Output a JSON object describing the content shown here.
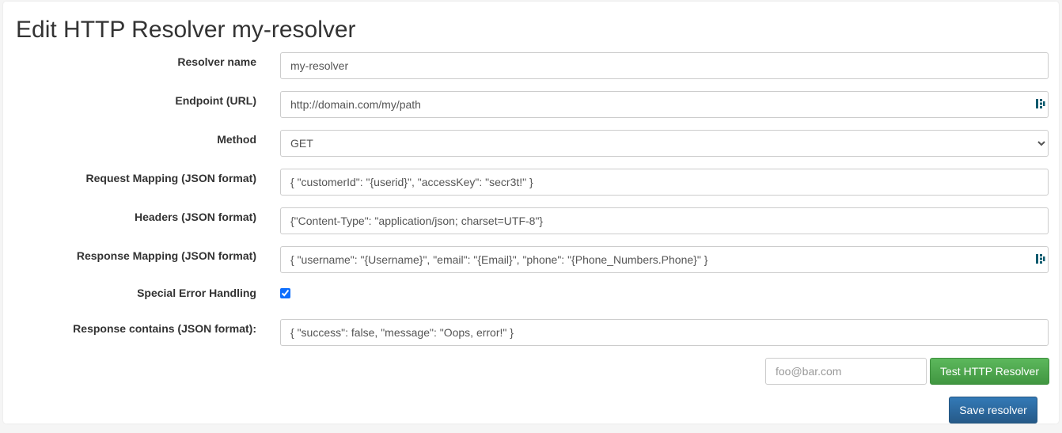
{
  "page": {
    "title": "Edit HTTP Resolver my-resolver"
  },
  "form": {
    "resolver_name": {
      "label": "Resolver name",
      "value": "my-resolver"
    },
    "endpoint": {
      "label": "Endpoint (URL)",
      "value": "http://domain.com/my/path"
    },
    "method": {
      "label": "Method",
      "value": "GET",
      "options": [
        "GET"
      ]
    },
    "request_mapping": {
      "label": "Request Mapping (JSON format)",
      "value": "{ \"customerId\": \"{userid}\", \"accessKey\": \"secr3t!\" }"
    },
    "headers": {
      "label": "Headers (JSON format)",
      "value": "{\"Content-Type\": \"application/json; charset=UTF-8\"}"
    },
    "response_mapping": {
      "label": "Response Mapping (JSON format)",
      "value": "{ \"username\": \"{Username}\", \"email\": \"{Email}\", \"phone\": \"{Phone_Numbers.Phone}\" }"
    },
    "special_error_handling": {
      "label": "Special Error Handling",
      "checked": true
    },
    "response_contains": {
      "label": "Response contains (JSON format):",
      "value": "{ \"success\": false, \"message\": \"Oops, error!\" }"
    }
  },
  "test": {
    "email_placeholder": "foo@bar.com",
    "button_label": "Test HTTP Resolver"
  },
  "actions": {
    "save_label": "Save resolver"
  },
  "icons": {
    "password_manager": "password-manager-icon"
  },
  "colors": {
    "success": "#5cb85c",
    "primary": "#337ab7",
    "checkbox": "#0d6efd",
    "password_icon": "#0a5a6e"
  }
}
